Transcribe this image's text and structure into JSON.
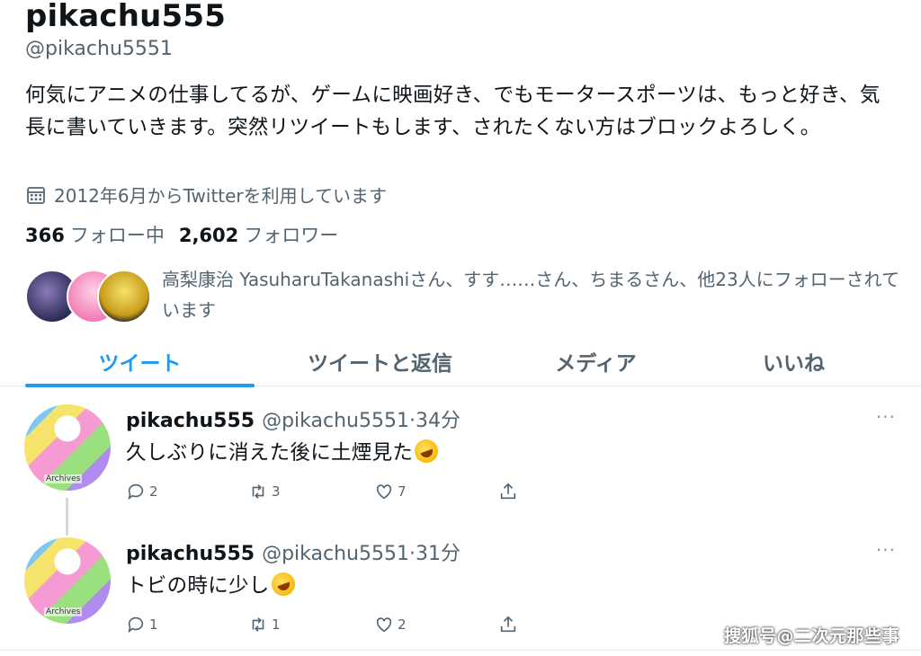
{
  "profile": {
    "display_name": "pikachu555",
    "handle": "@pikachu5551",
    "bio": "何気にアニメの仕事してるが、ゲームに映画好き、でもモータースポーツは、もっと好き、気長に書いていきます。突然リツイートもします、されたくない方はブロックよろしく。",
    "joined": "2012年6月からTwitterを利用しています",
    "following_count": "366",
    "following_label": "フォロー中",
    "followers_count": "2,602",
    "followers_label": "フォロワー",
    "followed_by_text": "高梨康治 YasuharuTakanashiさん、すす……さん、ちまるさん、他23人にフォローされています"
  },
  "tabs": [
    {
      "label": "ツイート",
      "active": true
    },
    {
      "label": "ツイートと返信",
      "active": false
    },
    {
      "label": "メディア",
      "active": false
    },
    {
      "label": "いいね",
      "active": false
    }
  ],
  "tweets": [
    {
      "name": "pikachu555",
      "handle": "@pikachu5551",
      "time": "·34分",
      "text": "久しぶりに消えた後に土煙見た",
      "avatar_caption": "Archives",
      "replies": "2",
      "retweets": "3",
      "likes": "7"
    },
    {
      "name": "pikachu555",
      "handle": "@pikachu5551",
      "time": "·31分",
      "text": "トビの時に少し",
      "avatar_caption": "Archives",
      "replies": "1",
      "retweets": "1",
      "likes": "2"
    }
  ],
  "more_glyph": "···",
  "watermark": "搜狐号@二次元那些事",
  "colors": {
    "accent": "#1d9bf0",
    "muted": "#536471",
    "text": "#0f1419"
  },
  "icons": [
    "calendar-icon",
    "reply-icon",
    "retweet-icon",
    "like-icon",
    "share-icon",
    "more-icon",
    "rofl-emoji-icon"
  ]
}
